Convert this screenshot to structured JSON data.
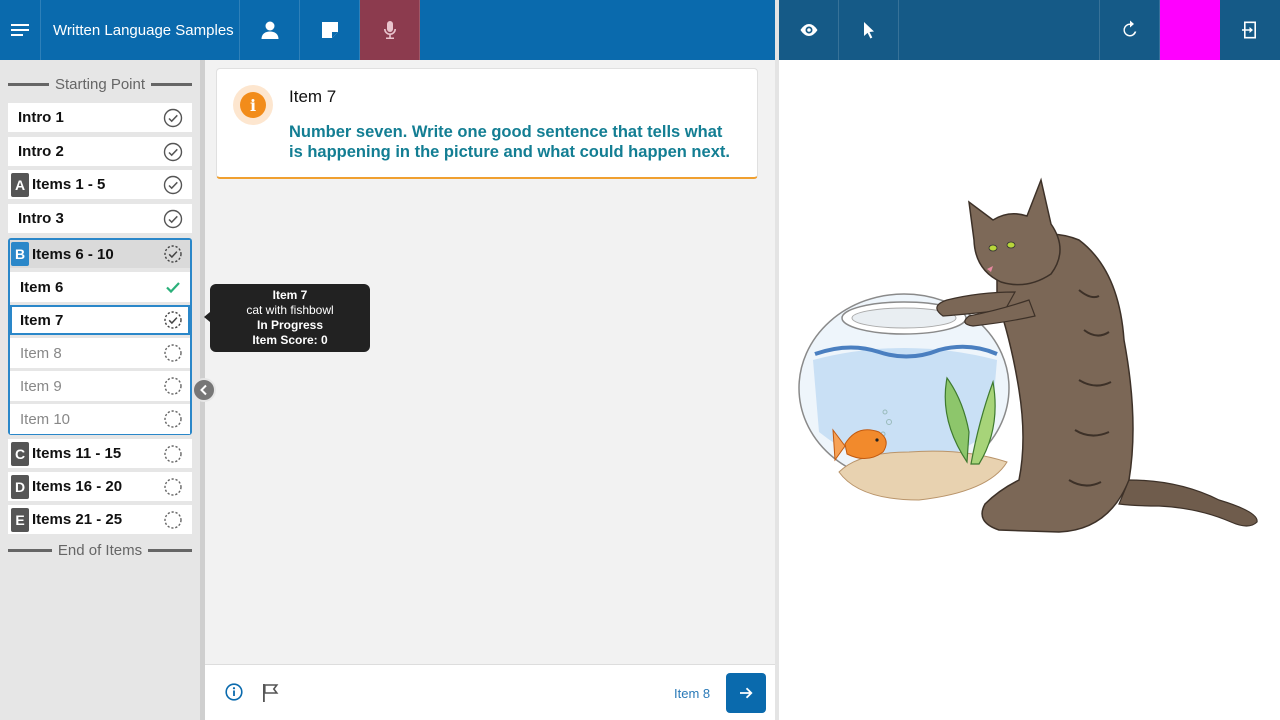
{
  "header": {
    "title": "Written Language Samples"
  },
  "sidebar": {
    "start_label": "Starting Point",
    "end_label": "End of Items",
    "items": [
      {
        "label": "Intro 1",
        "status": "complete"
      },
      {
        "label": "Intro 2",
        "status": "complete"
      },
      {
        "letter": "A",
        "label": "Items 1 - 5",
        "status": "complete"
      },
      {
        "label": "Intro 3",
        "status": "complete"
      }
    ],
    "group": {
      "letter": "B",
      "label": "Items 6 - 10",
      "status": "in-progress",
      "items": [
        {
          "label": "Item 6",
          "status": "correct"
        },
        {
          "label": "Item 7",
          "status": "in-progress"
        },
        {
          "label": "Item 8",
          "status": "not-started"
        },
        {
          "label": "Item 9",
          "status": "not-started"
        },
        {
          "label": "Item 10",
          "status": "not-started"
        }
      ]
    },
    "after": [
      {
        "letter": "C",
        "label": "Items 11 - 15",
        "status": "not-started"
      },
      {
        "letter": "D",
        "label": "Items 16 - 20",
        "status": "not-started"
      },
      {
        "letter": "E",
        "label": "Items 21 - 25",
        "status": "not-started"
      }
    ]
  },
  "tooltip": {
    "title": "Item 7",
    "subtitle": "cat with fishbowl",
    "status": "In Progress",
    "score": "Item Score: 0"
  },
  "card": {
    "title": "Item 7",
    "prompt": "Number seven. Write one good sentence that tells what is happening in the picture and what could happen next."
  },
  "footer": {
    "next_label": "Item 8"
  },
  "colors": {
    "header_left": "#0a6aad",
    "header_right": "#155a87",
    "mic_active": "#8c3b4e",
    "highlight": "#ff00ff",
    "group_accent": "#2a87c9",
    "prompt_text": "#137e93",
    "info_orange": "#f28c1a"
  },
  "icons": {
    "menu": "hamburger-menu-icon",
    "user": "user-icon",
    "notes": "note-icon",
    "mic": "microphone-icon",
    "eye": "eye-icon",
    "pointer": "pointer-icon",
    "refresh": "refresh-icon",
    "exit": "exit-icon"
  }
}
